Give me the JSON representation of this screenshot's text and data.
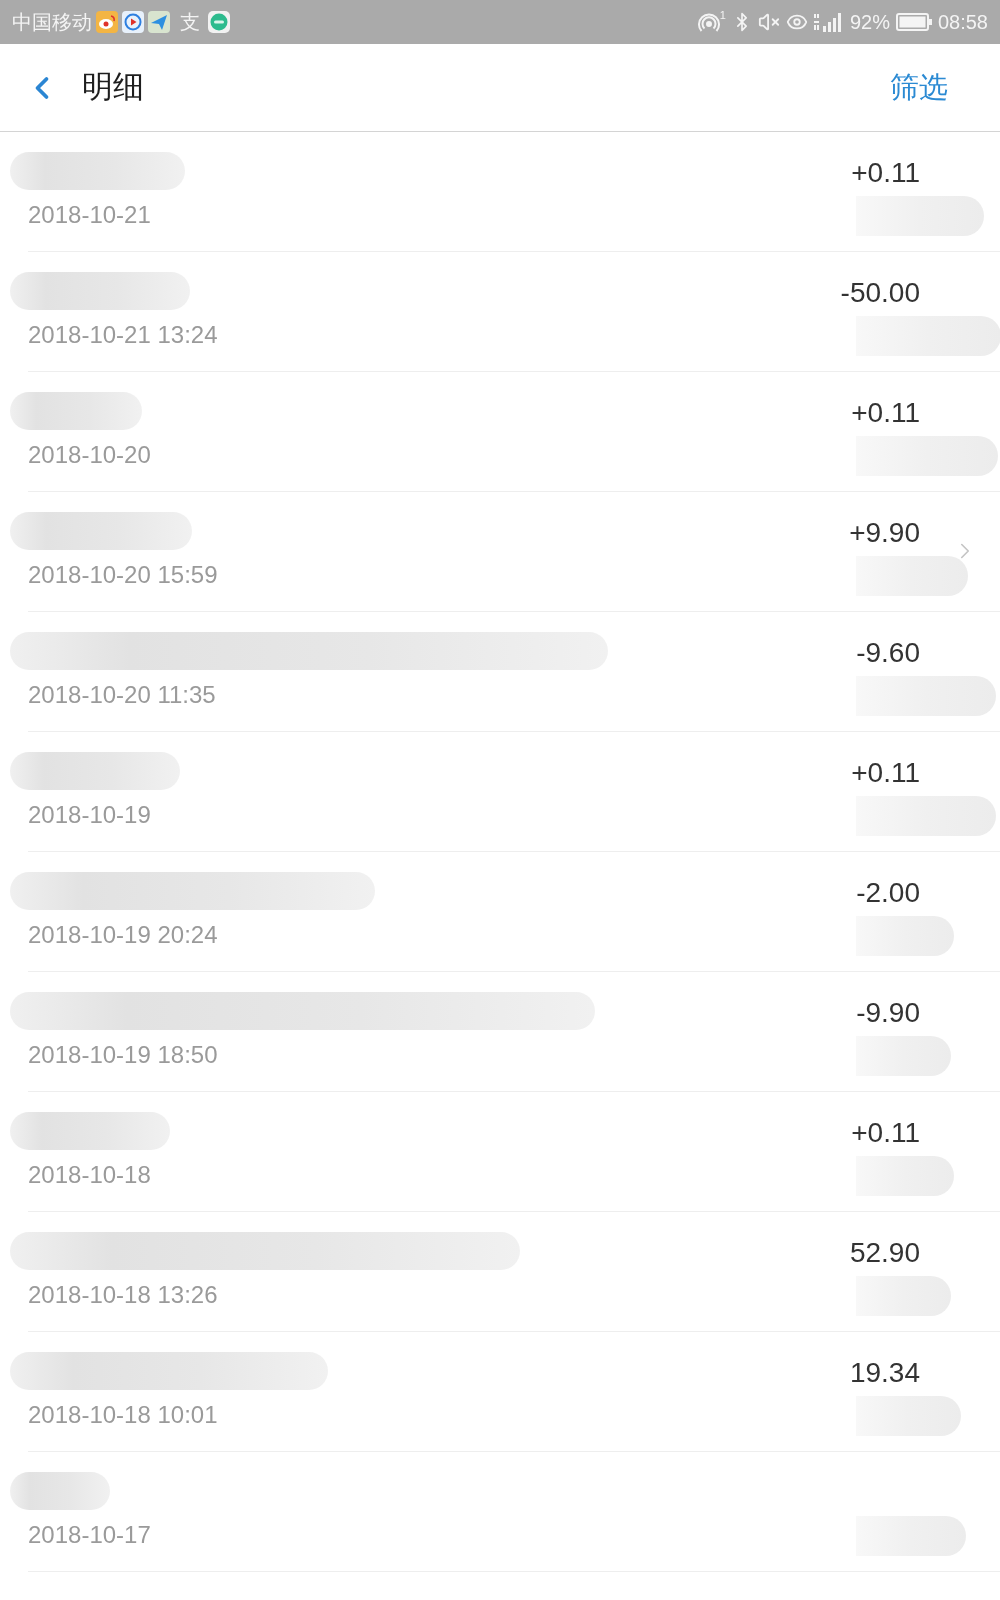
{
  "status_bar": {
    "carrier": "中国移动",
    "alipay_glyph": "支",
    "hotspot_count": "1",
    "battery": "92%",
    "time": "08:58"
  },
  "header": {
    "title": "明细",
    "filter": "筛选"
  },
  "rows": [
    {
      "title_redacted": true,
      "date": "2018-10-21",
      "amount": "+0.11",
      "balance_redacted": true,
      "arrow": false
    },
    {
      "title_redacted": true,
      "date": "2018-10-21 13:24",
      "amount": "-50.00",
      "balance_redacted": true,
      "arrow": false
    },
    {
      "title_redacted": true,
      "date": "2018-10-20",
      "amount": "+0.11",
      "balance_redacted": true,
      "arrow": false
    },
    {
      "title_redacted": true,
      "date": "2018-10-20 15:59",
      "amount": "+9.90",
      "balance_redacted": true,
      "arrow": true
    },
    {
      "title_redacted": true,
      "date": "2018-10-20 11:35",
      "amount": "-9.60",
      "balance_redacted": true,
      "arrow": false
    },
    {
      "title_redacted": true,
      "date": "2018-10-19",
      "amount": "+0.11",
      "balance_redacted": true,
      "arrow": false
    },
    {
      "title_redacted": true,
      "date": "2018-10-19 20:24",
      "amount": "-2.00",
      "balance_redacted": true,
      "arrow": false
    },
    {
      "title_redacted": true,
      "date": "2018-10-19 18:50",
      "amount": "-9.90",
      "balance_redacted": true,
      "arrow": false
    },
    {
      "title_redacted": true,
      "date": "2018-10-18",
      "amount": "+0.11",
      "balance_redacted": true,
      "arrow": false
    },
    {
      "title_redacted": true,
      "date": "2018-10-18 13:26",
      "amount": "52.90",
      "balance_redacted": true,
      "arrow": false
    },
    {
      "title_redacted": true,
      "date": "2018-10-18 10:01",
      "amount": "19.34",
      "balance_redacted": true,
      "arrow": false
    },
    {
      "title_redacted": true,
      "date": "2018-10-17",
      "balance_redacted": true,
      "arrow": false
    }
  ]
}
